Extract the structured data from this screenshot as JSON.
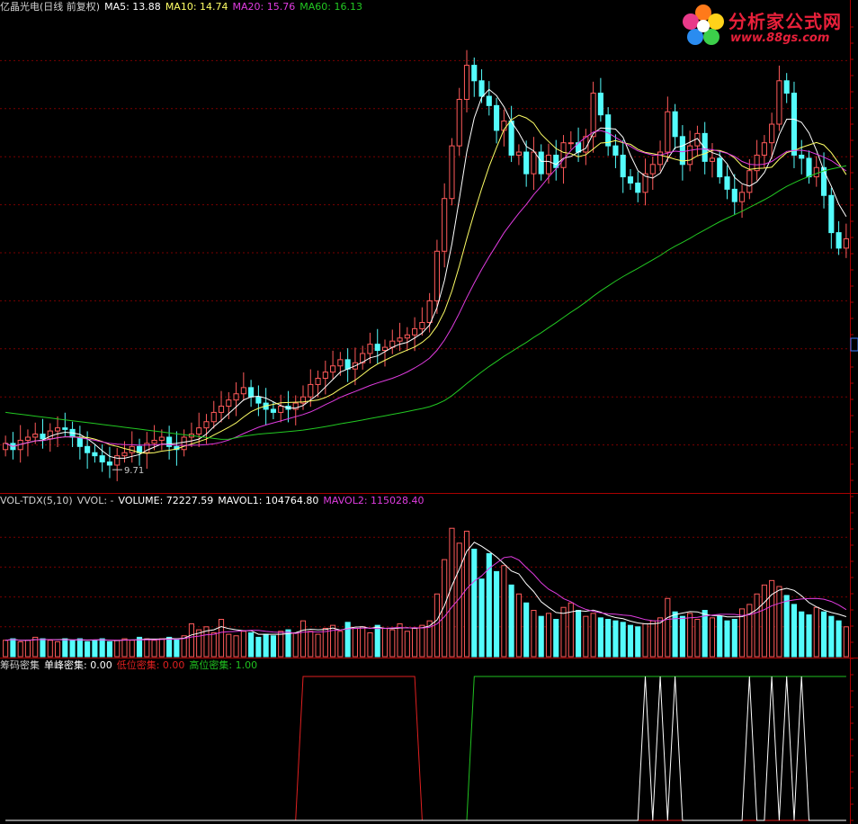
{
  "colors": {
    "up": "#ff5a5a",
    "down": "#54fcfc",
    "ma5": "#ffffff",
    "ma10": "#ffff66",
    "ma20": "#e03ce0",
    "ma60": "#22c822",
    "grid": "#7a0000",
    "frame": "#aa0000",
    "chip_low": "#e02020",
    "chip_high": "#20c020",
    "chip_single": "#ffffff"
  },
  "main_panel": {
    "title": "亿晶光电(日线 前复权)",
    "ma5_label": "MA5: 13.88",
    "ma10_label": "MA10: 14.74",
    "ma20_label": "MA20: 15.76",
    "ma60_label": "MA60: 16.13",
    "low_marker": "9.71"
  },
  "volume_panel": {
    "title": "VOL-TDX(5,10)",
    "vvol_label": "VVOL: -",
    "volume_label": "VOLUME: 72227.59",
    "mavol1_label": "MAVOL1: 104764.80",
    "mavol2_label": "MAVOL2: 115028.40"
  },
  "chip_panel": {
    "title": "筹码密集",
    "single_label": "单峰密集: 0.00",
    "low_label": "低位密集: 0.00",
    "high_label": "高位密集: 1.00"
  },
  "logo": {
    "name": "分析家公式网",
    "url_text": "www.88gs.com"
  },
  "chart_data": {
    "type": "candlestick",
    "price_range": [
      9.0,
      24.5
    ],
    "closes": [
      10.6,
      10.4,
      10.7,
      10.8,
      10.9,
      10.75,
      11.0,
      11.1,
      11.05,
      10.8,
      10.5,
      10.3,
      10.2,
      10.0,
      9.9,
      10.2,
      10.3,
      10.5,
      10.3,
      10.6,
      10.7,
      10.8,
      10.5,
      10.4,
      10.8,
      10.9,
      11.1,
      11.3,
      11.6,
      11.8,
      12.0,
      12.2,
      12.4,
      12.1,
      11.9,
      11.7,
      11.6,
      11.8,
      11.7,
      11.9,
      12.1,
      12.5,
      12.7,
      12.9,
      13.1,
      13.3,
      13.0,
      13.2,
      13.5,
      13.8,
      13.6,
      13.7,
      13.9,
      14.0,
      14.1,
      14.3,
      14.5,
      15.2,
      16.8,
      18.5,
      20.2,
      21.7,
      22.8,
      22.3,
      21.8,
      21.5,
      20.7,
      21.0,
      19.9,
      20.0,
      19.3,
      20.0,
      19.3,
      19.9,
      19.5,
      20.3,
      20.3,
      20.0,
      20.5,
      21.9,
      21.2,
      20.2,
      19.9,
      19.2,
      19.0,
      18.7,
      19.3,
      19.6,
      20.0,
      21.3,
      20.5,
      19.6,
      20.2,
      20.6,
      19.7,
      19.8,
      19.2,
      18.8,
      18.4,
      18.7,
      19.4,
      19.9,
      20.3,
      20.9,
      22.3,
      21.9,
      19.9,
      19.8,
      19.2,
      19.5,
      18.6,
      17.4,
      16.9,
      17.2
    ],
    "volumes": [
      0.11,
      0.12,
      0.1,
      0.11,
      0.13,
      0.12,
      0.11,
      0.1,
      0.12,
      0.11,
      0.12,
      0.1,
      0.11,
      0.12,
      0.1,
      0.11,
      0.12,
      0.11,
      0.13,
      0.12,
      0.11,
      0.12,
      0.13,
      0.12,
      0.14,
      0.22,
      0.18,
      0.2,
      0.16,
      0.25,
      0.15,
      0.14,
      0.17,
      0.16,
      0.13,
      0.15,
      0.14,
      0.17,
      0.18,
      0.16,
      0.24,
      0.17,
      0.15,
      0.19,
      0.21,
      0.17,
      0.23,
      0.19,
      0.2,
      0.16,
      0.21,
      0.19,
      0.18,
      0.22,
      0.17,
      0.19,
      0.21,
      0.24,
      0.42,
      0.65,
      0.86,
      0.76,
      0.84,
      0.72,
      0.52,
      0.69,
      0.57,
      0.61,
      0.48,
      0.42,
      0.36,
      0.31,
      0.27,
      0.29,
      0.25,
      0.33,
      0.36,
      0.31,
      0.27,
      0.29,
      0.26,
      0.25,
      0.24,
      0.23,
      0.21,
      0.2,
      0.22,
      0.24,
      0.26,
      0.39,
      0.3,
      0.27,
      0.29,
      0.25,
      0.31,
      0.26,
      0.27,
      0.24,
      0.25,
      0.32,
      0.35,
      0.42,
      0.48,
      0.51,
      0.47,
      0.41,
      0.35,
      0.3,
      0.28,
      0.33,
      0.3,
      0.27,
      0.24,
      0.2
    ],
    "chip_high": [
      0,
      0,
      0,
      0,
      0,
      0,
      0,
      0,
      0,
      0,
      0,
      0,
      0,
      0,
      0,
      0,
      0,
      0,
      0,
      0,
      0,
      0,
      0,
      0,
      0,
      0,
      0,
      0,
      0,
      0,
      0,
      0,
      0,
      0,
      0,
      0,
      0,
      0,
      0,
      0,
      0,
      0,
      0,
      0,
      0,
      0,
      0,
      0,
      0,
      0,
      0,
      0,
      0,
      0,
      0,
      0,
      0,
      0,
      0,
      0,
      0,
      0,
      0,
      1,
      1,
      1,
      1,
      1,
      1,
      1,
      1,
      1,
      1,
      1,
      1,
      1,
      1,
      1,
      1,
      1,
      1,
      1,
      1,
      1,
      1,
      1,
      1,
      1,
      1,
      1,
      1,
      1,
      1,
      1,
      1,
      1,
      1,
      1,
      1,
      1,
      1,
      1,
      1,
      1,
      1,
      1,
      1,
      1,
      1,
      1,
      1,
      1,
      1,
      1
    ],
    "chip_low": [
      0,
      0,
      0,
      0,
      0,
      0,
      0,
      0,
      0,
      0,
      0,
      0,
      0,
      0,
      0,
      0,
      0,
      0,
      0,
      0,
      0,
      0,
      0,
      0,
      0,
      0,
      0,
      0,
      0,
      0,
      0,
      0,
      0,
      0,
      0,
      0,
      0,
      0,
      0,
      0,
      1,
      1,
      1,
      1,
      1,
      1,
      1,
      1,
      1,
      1,
      1,
      1,
      1,
      1,
      1,
      1,
      0,
      0,
      0,
      0,
      0,
      0,
      0,
      0,
      0,
      0,
      0,
      0,
      0,
      0,
      0,
      0,
      0,
      0,
      0,
      0,
      0,
      0,
      0,
      0,
      0,
      0,
      0,
      0,
      0,
      0,
      0,
      0,
      0,
      0,
      0,
      0,
      0,
      0,
      0,
      0,
      0,
      0,
      0,
      0,
      0,
      0,
      0,
      0,
      0,
      0,
      0,
      0,
      0,
      0,
      0,
      0,
      0,
      0
    ],
    "chip_single": [
      0,
      0,
      0,
      0,
      0,
      0,
      0,
      0,
      0,
      0,
      0,
      0,
      0,
      0,
      0,
      0,
      0,
      0,
      0,
      0,
      0,
      0,
      0,
      0,
      0,
      0,
      0,
      0,
      0,
      0,
      0,
      0,
      0,
      0,
      0,
      0,
      0,
      0,
      0,
      0,
      0,
      0,
      0,
      0,
      0,
      0,
      0,
      0,
      0,
      0,
      0,
      0,
      0,
      0,
      0,
      0,
      0,
      0,
      0,
      0,
      0,
      0,
      0,
      0,
      0,
      0,
      0,
      0,
      0,
      0,
      0,
      0,
      0,
      0,
      0,
      0,
      0,
      0,
      0,
      0,
      0,
      0,
      0,
      0,
      0,
      0,
      1,
      0,
      1,
      0,
      1,
      0,
      0,
      0,
      0,
      0,
      0,
      0,
      0,
      0,
      1,
      0,
      0,
      1,
      0,
      1,
      0,
      1,
      0,
      0,
      0,
      0,
      0,
      0
    ]
  }
}
